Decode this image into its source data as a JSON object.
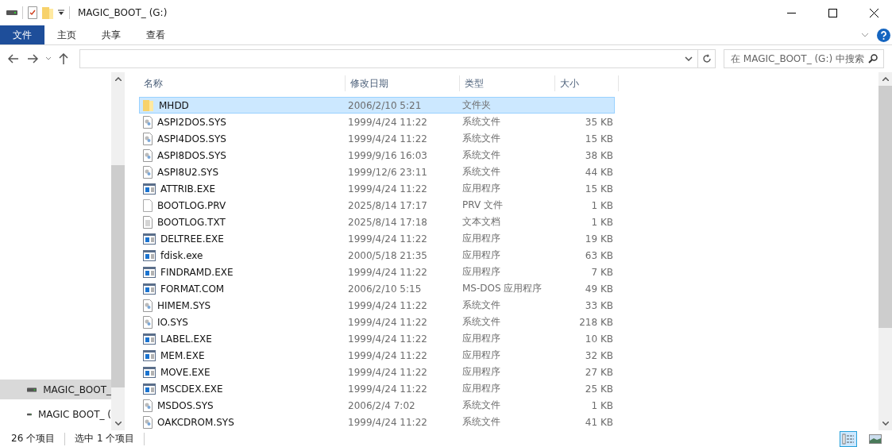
{
  "window": {
    "title": "MAGIC_BOOT_ (G:)"
  },
  "ribbon_tabs": [
    {
      "label": "文件",
      "selected": true
    },
    {
      "label": "主页",
      "selected": false
    },
    {
      "label": "共享",
      "selected": false
    },
    {
      "label": "查看",
      "selected": false
    }
  ],
  "search": {
    "placeholder": "在 MAGIC_BOOT_ (G:) 中搜索"
  },
  "nav_items": [
    {
      "label": "MAGIC_BOOT_",
      "selected": true
    },
    {
      "label": "MAGIC BOOT_ (",
      "selected": false
    }
  ],
  "table": {
    "columns": [
      "名称",
      "修改日期",
      "类型",
      "大小"
    ],
    "rows": [
      {
        "kind": "folder",
        "name": "MHDD",
        "date": "2006/2/10 5:21",
        "type": "文件夹",
        "size": "",
        "selected": true
      },
      {
        "kind": "sys",
        "name": "ASPI2DOS.SYS",
        "date": "1999/4/24 11:22",
        "type": "系统文件",
        "size": "35 KB",
        "selected": false
      },
      {
        "kind": "sys",
        "name": "ASPI4DOS.SYS",
        "date": "1999/4/24 11:22",
        "type": "系统文件",
        "size": "15 KB",
        "selected": false
      },
      {
        "kind": "sys",
        "name": "ASPI8DOS.SYS",
        "date": "1999/9/16 16:03",
        "type": "系统文件",
        "size": "38 KB",
        "selected": false
      },
      {
        "kind": "sys",
        "name": "ASPI8U2.SYS",
        "date": "1999/12/6 23:11",
        "type": "系统文件",
        "size": "44 KB",
        "selected": false
      },
      {
        "kind": "exe",
        "name": "ATTRIB.EXE",
        "date": "1999/4/24 11:22",
        "type": "应用程序",
        "size": "15 KB",
        "selected": false
      },
      {
        "kind": "blank",
        "name": "BOOTLOG.PRV",
        "date": "2025/8/14 17:17",
        "type": "PRV 文件",
        "size": "1 KB",
        "selected": false
      },
      {
        "kind": "txt",
        "name": "BOOTLOG.TXT",
        "date": "2025/8/14 17:18",
        "type": "文本文档",
        "size": "1 KB",
        "selected": false
      },
      {
        "kind": "exe",
        "name": "DELTREE.EXE",
        "date": "1999/4/24 11:22",
        "type": "应用程序",
        "size": "19 KB",
        "selected": false
      },
      {
        "kind": "exe",
        "name": "fdisk.exe",
        "date": "2000/5/18 21:35",
        "type": "应用程序",
        "size": "63 KB",
        "selected": false
      },
      {
        "kind": "exe",
        "name": "FINDRAMD.EXE",
        "date": "1999/4/24 11:22",
        "type": "应用程序",
        "size": "7 KB",
        "selected": false
      },
      {
        "kind": "exe",
        "name": "FORMAT.COM",
        "date": "2006/2/10 5:15",
        "type": "MS-DOS 应用程序",
        "size": "49 KB",
        "selected": false
      },
      {
        "kind": "sys",
        "name": "HIMEM.SYS",
        "date": "1999/4/24 11:22",
        "type": "系统文件",
        "size": "33 KB",
        "selected": false
      },
      {
        "kind": "sys",
        "name": "IO.SYS",
        "date": "1999/4/24 11:22",
        "type": "系统文件",
        "size": "218 KB",
        "selected": false
      },
      {
        "kind": "exe",
        "name": "LABEL.EXE",
        "date": "1999/4/24 11:22",
        "type": "应用程序",
        "size": "10 KB",
        "selected": false
      },
      {
        "kind": "exe",
        "name": "MEM.EXE",
        "date": "1999/4/24 11:22",
        "type": "应用程序",
        "size": "32 KB",
        "selected": false
      },
      {
        "kind": "exe",
        "name": "MOVE.EXE",
        "date": "1999/4/24 11:22",
        "type": "应用程序",
        "size": "27 KB",
        "selected": false
      },
      {
        "kind": "exe",
        "name": "MSCDEX.EXE",
        "date": "1999/4/24 11:22",
        "type": "应用程序",
        "size": "25 KB",
        "selected": false
      },
      {
        "kind": "sys",
        "name": "MSDOS.SYS",
        "date": "2006/2/4 7:02",
        "type": "系统文件",
        "size": "1 KB",
        "selected": false
      },
      {
        "kind": "sys",
        "name": "OAKCDROM.SYS",
        "date": "1999/4/24 11:22",
        "type": "系统文件",
        "size": "41 KB",
        "selected": false
      }
    ]
  },
  "status_bar": {
    "count": "26 个项目",
    "selection": "选中 1 个项目"
  }
}
